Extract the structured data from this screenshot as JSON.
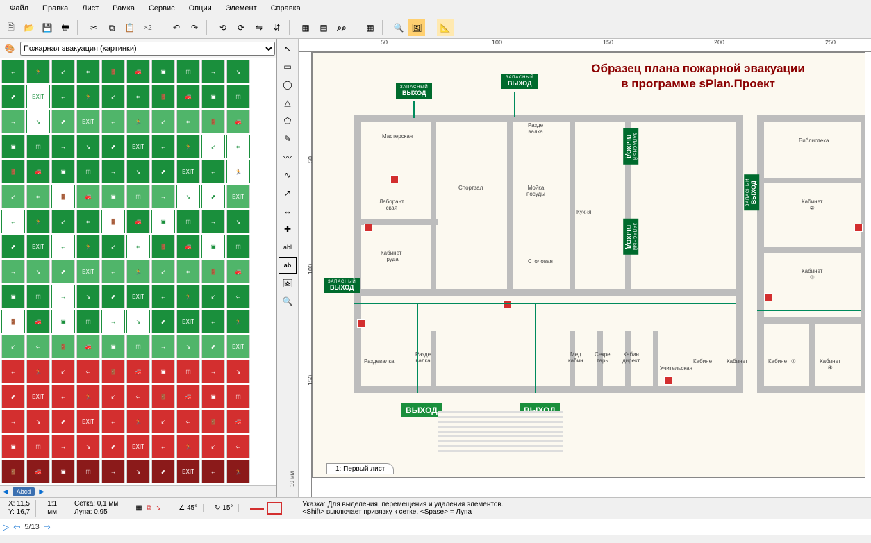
{
  "menu": [
    "Файл",
    "Правка",
    "Лист",
    "Рамка",
    "Сервис",
    "Опции",
    "Элемент",
    "Справка"
  ],
  "toolbar_icons": [
    "new-file-icon",
    "open-folder-icon",
    "save-icon",
    "print-icon",
    "",
    "cut-icon",
    "copy-icon",
    "paste-icon",
    "x2-dup-icon",
    "",
    "undo-icon",
    "redo-icon",
    "",
    "rotate-left-icon",
    "rotate-right-icon",
    "flip-h-icon",
    "flip-v-icon",
    "",
    "align-group-icon",
    "align-center-icon",
    "find-icon",
    "",
    "grid-icon",
    "",
    "magnifier-box-icon",
    "preview-icon",
    "",
    "ruler-icon"
  ],
  "library": {
    "selected": "Пожарная эвакуация (картинки)",
    "options": [
      "Пожарная эвакуация (картинки)"
    ]
  },
  "vert_tools": [
    "pointer-icon",
    "rect-icon",
    "circle-icon",
    "triangle-icon",
    "polygon-icon",
    "freehand-icon",
    "curve-icon",
    "bezier-icon",
    "arrow-icon",
    "dimension-icon",
    "plus-node-icon",
    "text-abl-icon",
    "text-ab-icon",
    "image-icon",
    "zoom-icon"
  ],
  "vert_labels": {
    "text_abl": "abl",
    "text_ab": "ab"
  },
  "sheet_tab": {
    "index": "1:",
    "name": "Первый лист"
  },
  "symbols_nav": {
    "badge": "Abcd"
  },
  "ruler_top": [
    "50",
    "100",
    "150",
    "200",
    "250"
  ],
  "ruler_left": [
    "50",
    "100",
    "150"
  ],
  "mm_label": "10 мм",
  "plan": {
    "title_line1": "Образец плана пожарной эвакуации",
    "title_line2": "в программе sPlan.Проект",
    "exits": {
      "top1": "ВЫХОД",
      "top1s": "ЗАПАСНЫЙ",
      "top2": "ВЫХОД",
      "top2s": "ЗАПАСНЫЙ",
      "left": "ВЫХОД",
      "lefts": "ЗАПАСНЫЙ",
      "right1": "ВЫХОД",
      "right1s": "ЗАПАСНЫЙ",
      "right2": "ВЫХОД",
      "right2s": "ЗАПАСНЫЙ",
      "rightfar": "ВЫХОД",
      "rightfars": "ЗАПАСНЫЙ",
      "bottom1": "ВЫХОД",
      "bottom2": "ВЫХОД"
    },
    "rooms": {
      "masterskaya": "Мастерская",
      "laborant": "Лаборант\nская",
      "sportzal": "Спортзал",
      "razdevalka_l": "Разде\nвалка",
      "moika": "Мойка\nпосуды",
      "kuhnya": "Кухня",
      "kabtruda": "Кабинет\nтруда",
      "stolovaya": "Столовая",
      "razdevalka2": "Раздевалка",
      "razdevalka2b": "Разде\nвалка",
      "med": "Мед\nкабин",
      "sekre": "Секре\nтарь",
      "kabdir": "Кабин\nдирект",
      "uchit": "Учительская",
      "kabinet": "Кабинет",
      "kabinet1": "Кабинет ①",
      "kabinet2": "Кабинет\n②",
      "kabinet3": "Кабинет\n③",
      "kabinet4": "Кабинет\n④",
      "biblio": "Библиотека"
    }
  },
  "status": {
    "x": "X: 11,5",
    "y": "Y: 16,7",
    "scale": "1:1",
    "scale_unit": "мм",
    "grid": "Сетка: 0,1 мм",
    "zoom": "Лупа:  0,95",
    "angle45": "45°",
    "angle15": "15°",
    "hint_line1": "Указка: Для выделения, перемещения и удаления элементов.",
    "hint_line2": "<Shift> выключает привязку к сетке. <Spase> = Лупа"
  },
  "pager": {
    "pos": "5/13"
  }
}
